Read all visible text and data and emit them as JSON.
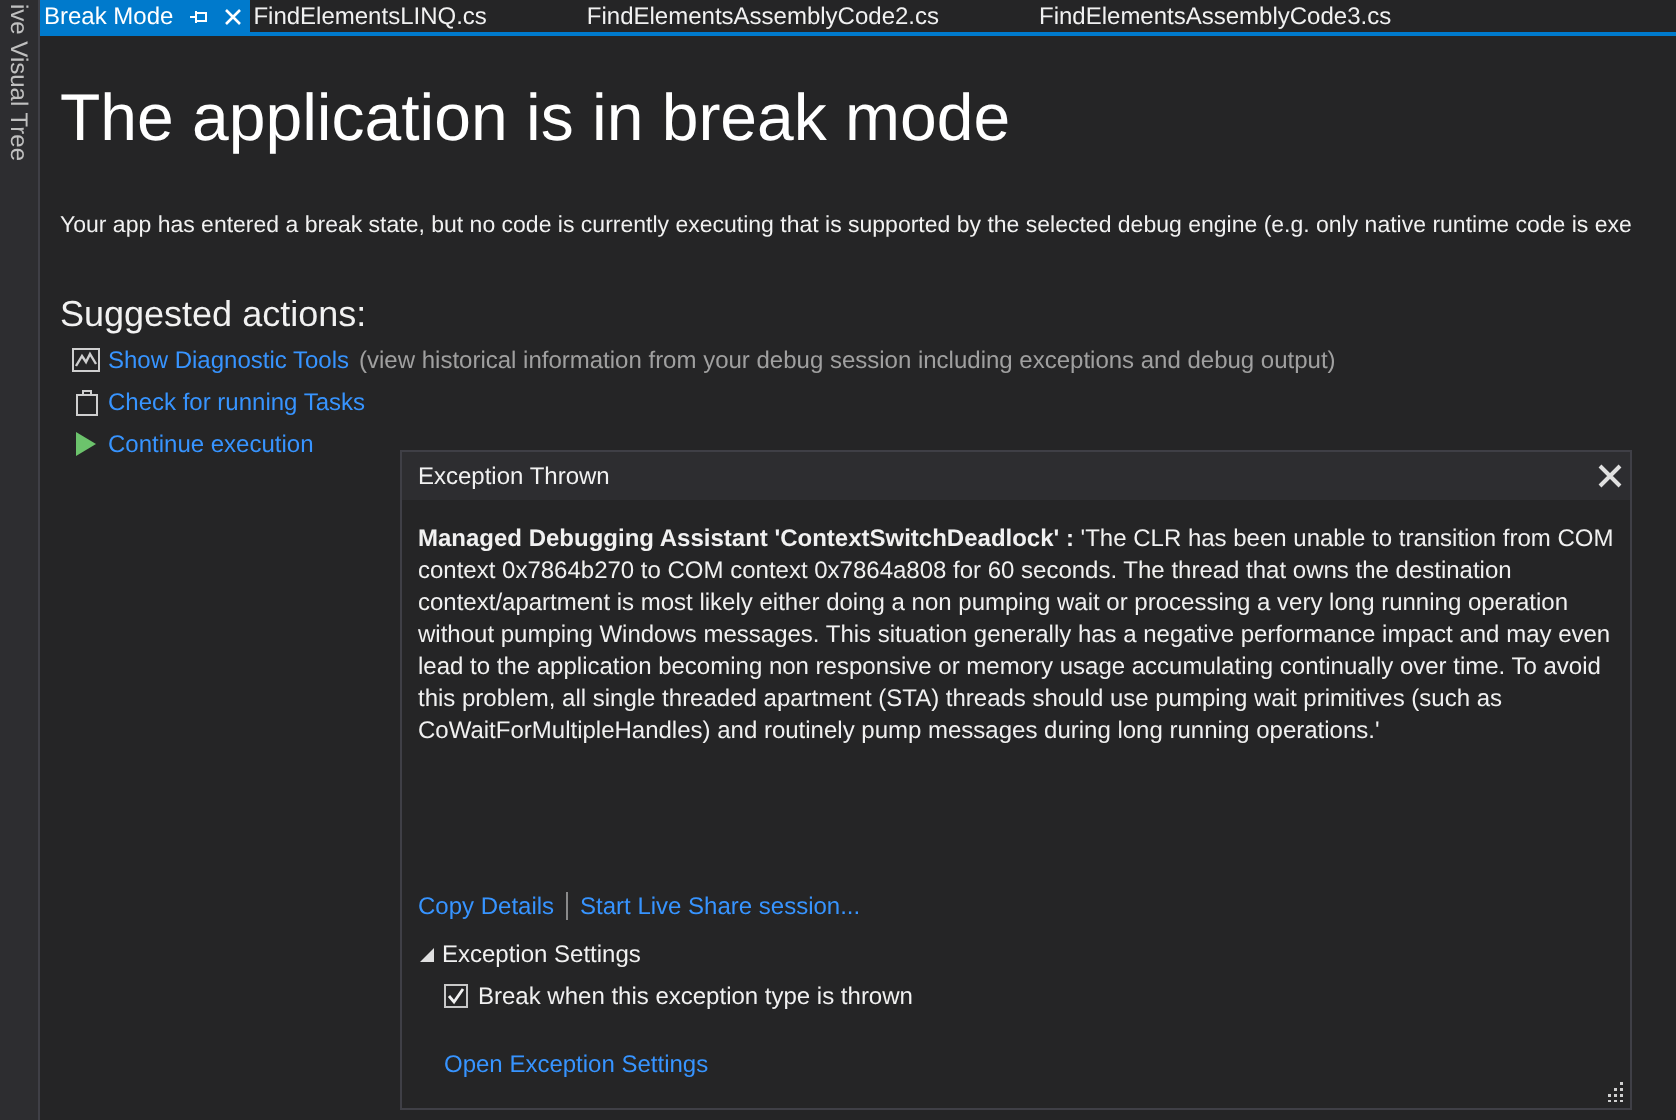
{
  "side_panel": {
    "title": "ive Visual Tree"
  },
  "tabs": [
    {
      "label": "Break Mode",
      "selected": true,
      "pinned": true
    },
    {
      "label": "FindElementsLINQ.cs",
      "selected": false,
      "pinned": false
    },
    {
      "label": "FindElementsAssemblyCode2.cs",
      "selected": false,
      "pinned": false
    },
    {
      "label": "FindElementsAssemblyCode3.cs",
      "selected": false,
      "pinned": false
    }
  ],
  "heading": "The application is in break mode",
  "description": "Your app has entered a break state, but no code is currently executing that is supported by the selected debug engine (e.g. only native runtime code is exe",
  "suggested_actions": {
    "title": "Suggested actions:",
    "items": [
      {
        "kind": "diagnostic",
        "link": "Show Diagnostic Tools",
        "note": "(view historical information from your debug session including exceptions and debug output)"
      },
      {
        "kind": "tasks",
        "link": "Check for running Tasks"
      },
      {
        "kind": "continue",
        "link": "Continue execution"
      }
    ]
  },
  "exception_popup": {
    "title": "Exception Thrown",
    "message": "**Managed Debugging Assistant 'ContextSwitchDeadlock' :** 'The CLR has been unable to transition from COM context 0x7864b270 to COM context 0x7864a808 for 60 seconds. The thread that owns the destination context/apartment is most likely either doing a non pumping wait or processing a very long running operation without pumping Windows messages. This situation generally has a negative performance impact and may even lead to the application becoming non responsive or memory usage accumulating continually over time. To avoid this problem, all single threaded apartment (STA) threads should use pumping wait primitives (such as CoWaitForMultipleHandles) and routinely pump messages during long running operations.'",
    "links": [
      "Copy Details",
      "Start Live Share session..."
    ],
    "settings": {
      "title": "Exception Settings",
      "expanded": true,
      "option": {
        "label": "Break when this exception type is thrown",
        "checked": true
      }
    },
    "footer_link": "Open Exception Settings"
  }
}
